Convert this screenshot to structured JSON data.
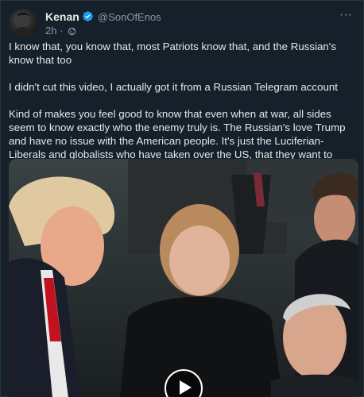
{
  "post": {
    "author": {
      "display_name": "Kenan",
      "handle": "@SonOfEnos",
      "verified_icon": "verified-badge-icon"
    },
    "time_ago": "2h",
    "visibility_icon": "globe-icon",
    "more_label": "···",
    "paragraphs": [
      "I know that, you know that, most Patriots know that, and the Russian's know that too",
      "I didn't cut this video, I actually got it from a Russian Telegram account",
      "Kind of makes you feel good to know that even when at war, all sides seem to know exactly who the enemy truly is. The Russian's love Trump and have no issue with the American people. It's just the Luciferian-Liberals and globalists who have taken over the US, that they want to destroy. But then again, don't we all?"
    ],
    "media": {
      "type": "video",
      "play_icon": "play-icon"
    }
  },
  "colors": {
    "background": "#15202b",
    "text_primary": "#e7e9ea",
    "text_secondary": "#8b98a5",
    "verified": "#1d9bf0"
  }
}
